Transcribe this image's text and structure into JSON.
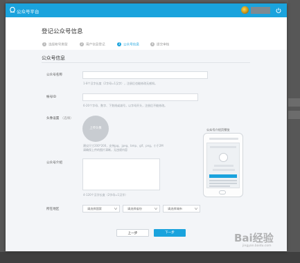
{
  "topbar": {
    "brand": "公众号平台",
    "avatar_icon": "user-avatar-icon",
    "power_icon": "power-icon"
  },
  "header": {
    "title": "登记公众号信息",
    "steps": [
      {
        "num": "1",
        "label": "选择帐号类型",
        "state": "done"
      },
      {
        "num": "2",
        "label": "用户信息登记",
        "state": "done"
      },
      {
        "num": "3",
        "label": "公众号信息",
        "state": "active"
      },
      {
        "num": "4",
        "label": "提交审核",
        "state": "todo"
      }
    ]
  },
  "form": {
    "section_title": "公众号信息",
    "name": {
      "label": "公众号名称",
      "value": "",
      "hint": "1-8个汉字长度（2字母=1汉字），注册后也能修改无感知。"
    },
    "account_id": {
      "label": "帐号ID",
      "value": "",
      "hint": "6-20个字母、数字、下划线或减号，以字母开头，注册后不能修改。"
    },
    "avatar": {
      "label": "头像设置",
      "label_sub": "（选填）",
      "upload_text": "上传头像",
      "hint_1": "建议尺寸200*200，支持jpg、jpeg、bmp、gif、png，小于2M",
      "hint_2": "请确保上传的图片清晰，无违规内容"
    },
    "intro": {
      "label": "公众号介绍",
      "value": "",
      "hint": "4-120个汉字长度（2字母=1汉字）"
    },
    "region": {
      "label": "所在地区",
      "selects": [
        {
          "value": "请选择国家"
        },
        {
          "value": "请选择省份"
        },
        {
          "value": "请选择城市"
        }
      ]
    }
  },
  "preview": {
    "caption": "公众号介绍页预览"
  },
  "actions": {
    "prev_label": "上一步",
    "next_label": "下一步"
  },
  "watermark": {
    "text": "Bai经验",
    "sub": "jingyan.baidu.com"
  },
  "colors": {
    "accent": "#1aa3dd",
    "topbar": "#1aa3dd",
    "page_bg": "#f3f5f8"
  }
}
